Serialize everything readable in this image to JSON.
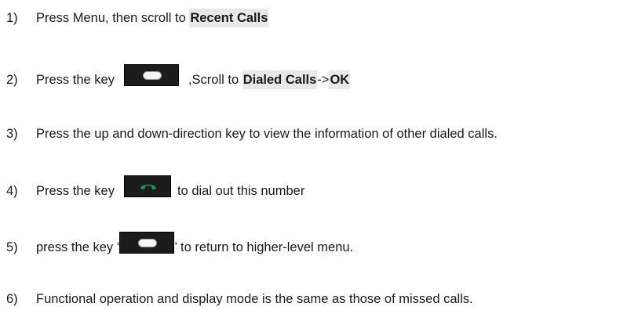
{
  "steps": [
    {
      "num": "1)",
      "text_a": "Press Menu, then scroll to ",
      "hl_a": "Recent Calls"
    },
    {
      "num": "2)",
      "text_a": "Press the key",
      "key_icon": "soft-key-icon",
      "text_b": ",Scroll to ",
      "hl_a": "Dialed Calls",
      "text_c": "->",
      "hl_b": "OK"
    },
    {
      "num": "3)",
      "text_a": "Press the up and down-direction key to view the information of other dialed calls."
    },
    {
      "num": "4)",
      "text_a": "Press the key",
      "key_icon": "call-key-icon",
      "text_b": "to dial out this number"
    },
    {
      "num": "5)",
      "text_a": "press the key ‘",
      "key_icon": "soft-key-icon",
      "text_b": "’ to return to higher-level menu."
    },
    {
      "num": "6)",
      "text_a": "Functional operation and display mode is the same as those of missed calls."
    }
  ],
  "colors": {
    "text": "#1a1a1a",
    "highlight_bg": "#e8e8e8",
    "key_bg": "#1c1c1c",
    "call_green": "#1f9a4a"
  }
}
